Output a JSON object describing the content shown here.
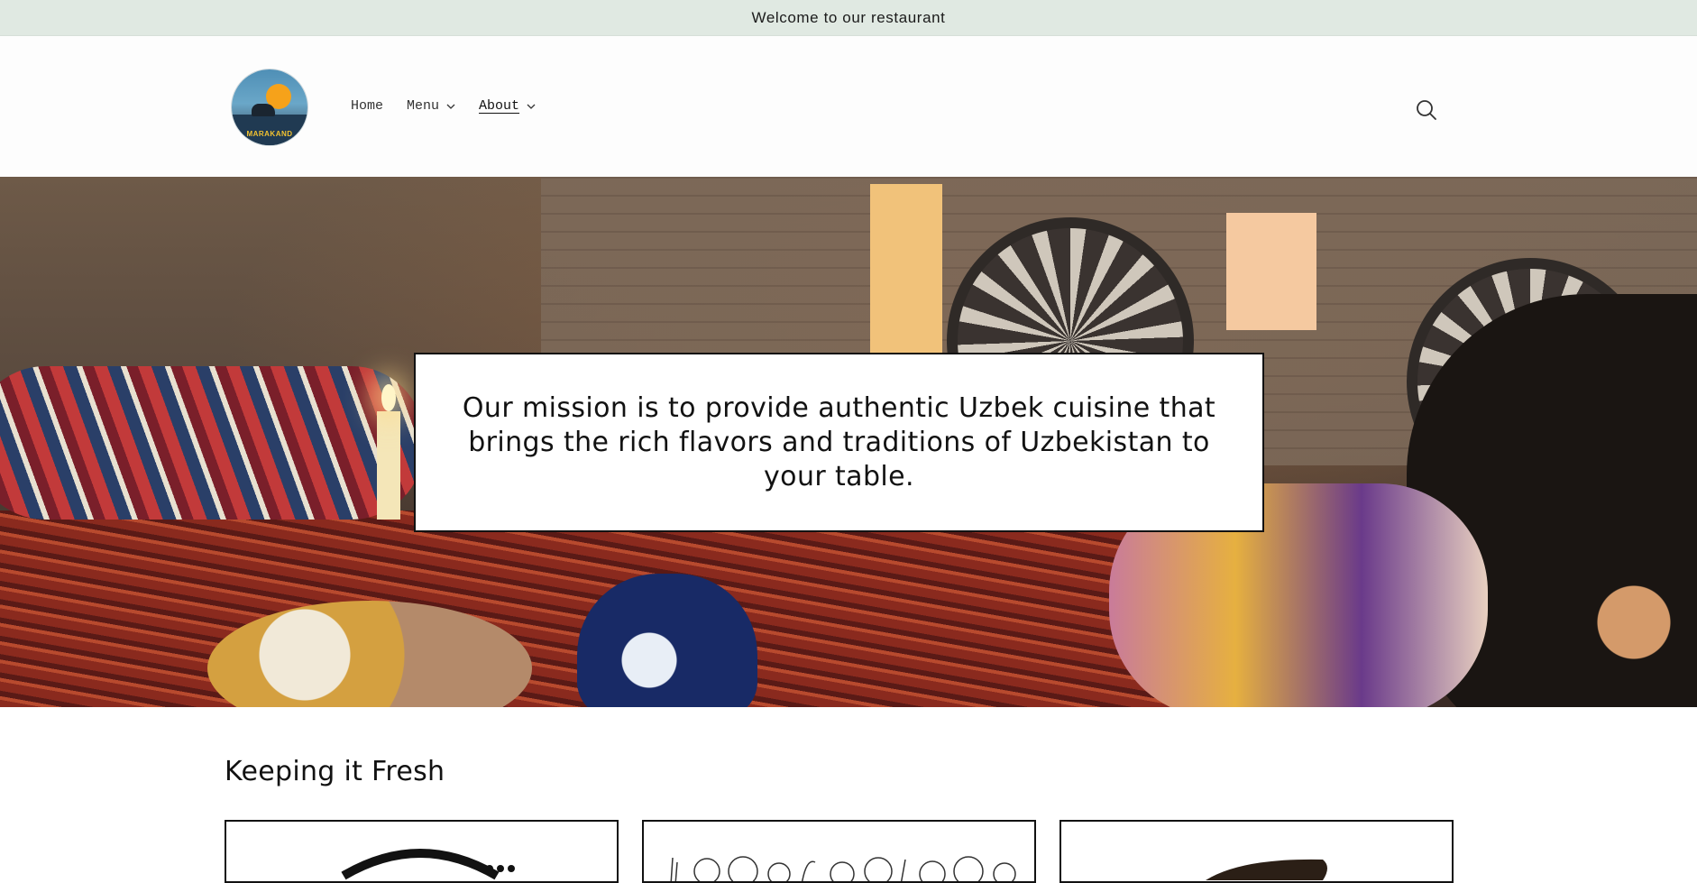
{
  "announcement": {
    "text": "Welcome to our restaurant"
  },
  "header": {
    "logo_text": "MARAKAND",
    "nav": [
      {
        "label": "Home",
        "has_dropdown": false,
        "active": false
      },
      {
        "label": "Menu",
        "has_dropdown": true,
        "active": false
      },
      {
        "label": "About",
        "has_dropdown": true,
        "active": true
      }
    ],
    "icons": {
      "search": "search-icon",
      "dropdown": "chevron-down-icon"
    }
  },
  "hero": {
    "mission_text": "Our mission is to provide authentic Uzbek cuisine that brings the rich flavors and traditions of Uzbekistan to your table."
  },
  "fresh_section": {
    "title": "Keeping it Fresh",
    "cards": [
      {
        "image": "bowl-illustration"
      },
      {
        "image": "vegetables-illustration"
      },
      {
        "image": "bread-illustration"
      }
    ]
  },
  "colors": {
    "announcement_bg": "#e0e9e2",
    "text": "#121212",
    "border": "#121212"
  }
}
